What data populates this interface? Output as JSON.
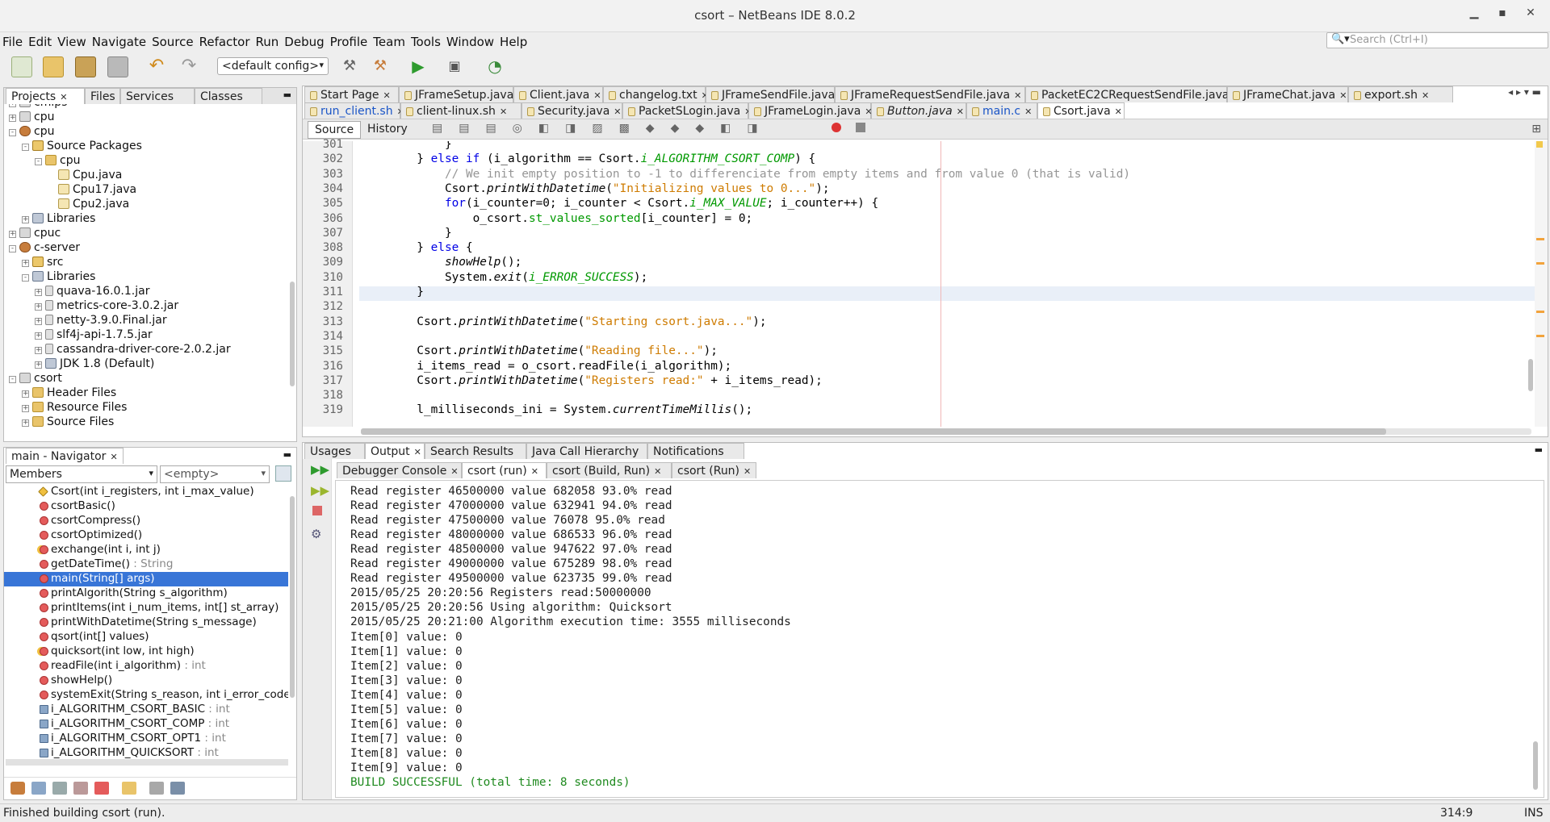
{
  "window": {
    "title": "csort – NetBeans IDE 8.0.2"
  },
  "menu": [
    "File",
    "Edit",
    "View",
    "Navigate",
    "Source",
    "Refactor",
    "Run",
    "Debug",
    "Profile",
    "Team",
    "Tools",
    "Window",
    "Help"
  ],
  "search": {
    "placeholder": "Search (Ctrl+I)"
  },
  "toolbar": {
    "config": "<default config>"
  },
  "projects_panel": {
    "tabs": [
      "Projects",
      "Files",
      "Services",
      "Classes"
    ],
    "tree": [
      {
        "indent": 0,
        "exp": "+",
        "icon": "proj",
        "label": "cmips"
      },
      {
        "indent": 0,
        "exp": "+",
        "icon": "proj",
        "label": "cpu"
      },
      {
        "indent": 0,
        "exp": "-",
        "icon": "cup",
        "label": "cpu"
      },
      {
        "indent": 1,
        "exp": "-",
        "icon": "pkg",
        "label": "Source Packages"
      },
      {
        "indent": 2,
        "exp": "-",
        "icon": "folder",
        "label": "cpu"
      },
      {
        "indent": 3,
        "exp": "",
        "icon": "java",
        "label": "Cpu.java"
      },
      {
        "indent": 3,
        "exp": "",
        "icon": "java",
        "label": "Cpu17.java"
      },
      {
        "indent": 3,
        "exp": "",
        "icon": "java",
        "label": "Cpu2.java"
      },
      {
        "indent": 1,
        "exp": "+",
        "icon": "lib",
        "label": "Libraries"
      },
      {
        "indent": 0,
        "exp": "+",
        "icon": "proj",
        "label": "cpuc"
      },
      {
        "indent": 0,
        "exp": "-",
        "icon": "cup",
        "label": "c-server"
      },
      {
        "indent": 1,
        "exp": "+",
        "icon": "pkg",
        "label": "src"
      },
      {
        "indent": 1,
        "exp": "-",
        "icon": "lib",
        "label": "Libraries"
      },
      {
        "indent": 2,
        "exp": "+",
        "icon": "jar",
        "label": "quava-16.0.1.jar"
      },
      {
        "indent": 2,
        "exp": "+",
        "icon": "jar",
        "label": "metrics-core-3.0.2.jar"
      },
      {
        "indent": 2,
        "exp": "+",
        "icon": "jar",
        "label": "netty-3.9.0.Final.jar"
      },
      {
        "indent": 2,
        "exp": "+",
        "icon": "jar",
        "label": "slf4j-api-1.7.5.jar"
      },
      {
        "indent": 2,
        "exp": "+",
        "icon": "jar",
        "label": "cassandra-driver-core-2.0.2.jar"
      },
      {
        "indent": 2,
        "exp": "+",
        "icon": "lib",
        "label": "JDK 1.8 (Default)"
      },
      {
        "indent": 0,
        "exp": "-",
        "icon": "proj",
        "label": "csort"
      },
      {
        "indent": 1,
        "exp": "+",
        "icon": "folder",
        "label": "Header Files"
      },
      {
        "indent": 1,
        "exp": "+",
        "icon": "folder",
        "label": "Resource Files"
      },
      {
        "indent": 1,
        "exp": "+",
        "icon": "folder",
        "label": "Source Files"
      }
    ]
  },
  "navigator": {
    "title": "main - Navigator",
    "filter": "Members",
    "empty": "<empty>",
    "items": [
      {
        "kind": "ctor",
        "name": "Csort(int i_registers, int i_max_value)",
        "type": ""
      },
      {
        "kind": "method",
        "name": "csortBasic()",
        "type": ""
      },
      {
        "kind": "method",
        "name": "csortCompress()",
        "type": ""
      },
      {
        "kind": "method",
        "name": "csortOptimized()",
        "type": ""
      },
      {
        "kind": "prot",
        "name": "exchange(int i, int j)",
        "type": ""
      },
      {
        "kind": "method",
        "name": "getDateTime()",
        "type": " : String"
      },
      {
        "kind": "method",
        "name": "main(String[] args)",
        "type": ""
      },
      {
        "kind": "method",
        "name": "printAlgorith(String s_algorithm)",
        "type": ""
      },
      {
        "kind": "method",
        "name": "printItems(int i_num_items, int[] st_array)",
        "type": ""
      },
      {
        "kind": "method",
        "name": "printWithDatetime(String s_message)",
        "type": ""
      },
      {
        "kind": "method",
        "name": "qsort(int[] values)",
        "type": ""
      },
      {
        "kind": "prot",
        "name": "quicksort(int low, int high)",
        "type": ""
      },
      {
        "kind": "method",
        "name": "readFile(int i_algorithm)",
        "type": " : int"
      },
      {
        "kind": "method",
        "name": "showHelp()",
        "type": ""
      },
      {
        "kind": "method",
        "name": "systemExit(String s_reason, int i_error_code",
        "type": ""
      },
      {
        "kind": "fieldico",
        "name": "i_ALGORITHM_CSORT_BASIC",
        "type": " : int"
      },
      {
        "kind": "fieldico",
        "name": "i_ALGORITHM_CSORT_COMP",
        "type": " : int"
      },
      {
        "kind": "fieldico",
        "name": "i_ALGORITHM_CSORT_OPT1",
        "type": " : int"
      },
      {
        "kind": "fieldico",
        "name": "i_ALGORITHM_QUICKSORT",
        "type": " : int"
      }
    ]
  },
  "editor": {
    "tabs_row1": [
      "Start Page",
      "JFrameSetup.java",
      "Client.java",
      "changelog.txt",
      "JFrameSendFile.java",
      "JFrameRequestSendFile.java",
      "PacketEC2CRequestSendFile.java",
      "JFrameChat.java",
      "export.sh"
    ],
    "tabs_row2": [
      "run_client.sh",
      "client-linux.sh",
      "Security.java",
      "PacketSLogin.java",
      "JFrameLogin.java",
      "Button.java",
      "main.c",
      "Csort.java"
    ],
    "source_tab": "Source",
    "history_tab": "History",
    "lines": [
      {
        "n": "301",
        "html": "            }"
      },
      {
        "n": "302",
        "html": "        } <span class=\"kw\">else if</span> (i_algorithm == Csort.<span class=\"sfld\">i_ALGORITHM_CSORT_COMP</span>) {"
      },
      {
        "n": "303",
        "html": "            <span class=\"cm\">// We init empty position to -1 to differenciate from empty items and from value 0 (that is valid)</span>"
      },
      {
        "n": "304",
        "html": "            Csort.<span class=\"it\">printWithDatetime</span>(<span class=\"str\">\"Initializing values to 0...\"</span>);"
      },
      {
        "n": "305",
        "html": "            <span class=\"kw\">for</span>(i_counter=0; i_counter &lt; Csort.<span class=\"sfld\">i_MAX_VALUE</span>; i_counter++) {"
      },
      {
        "n": "306",
        "html": "                o_csort.<span class=\"fld\">st_values_sorted</span>[i_counter] = 0;"
      },
      {
        "n": "307",
        "html": "            }"
      },
      {
        "n": "308",
        "html": "        } <span class=\"kw\">else</span> {"
      },
      {
        "n": "309",
        "html": "            <span class=\"it\">showHelp</span>();"
      },
      {
        "n": "310",
        "html": "            System.<span class=\"it\">exit</span>(<span class=\"sfld\">i_ERROR_SUCCESS</span>);"
      },
      {
        "n": "311",
        "html": "        }"
      },
      {
        "n": "312",
        "html": ""
      },
      {
        "n": "313",
        "html": "        Csort.<span class=\"it\">printWithDatetime</span>(<span class=\"str\">\"Starting csort.java...\"</span>);"
      },
      {
        "n": "314",
        "html": ""
      },
      {
        "n": "315",
        "html": "        Csort.<span class=\"it\">printWithDatetime</span>(<span class=\"str\">\"Reading file...\"</span>);"
      },
      {
        "n": "316",
        "html": "        i_items_read = o_csort.readFile(i_algorithm);"
      },
      {
        "n": "317",
        "html": "        Csort.<span class=\"it\">printWithDatetime</span>(<span class=\"str\">\"Registers read:\"</span> + i_items_read);"
      },
      {
        "n": "318",
        "html": ""
      },
      {
        "n": "319",
        "html": "        l_milliseconds_ini = System.<span class=\"it\">currentTimeMillis</span>();"
      }
    ]
  },
  "bottom_panel": {
    "tabs": [
      "Usages",
      "Output",
      "Search Results",
      "Java Call Hierarchy",
      "Notifications"
    ],
    "output_tabs": [
      "Debugger Console",
      "csort (run)",
      "csort (Build, Run)",
      "csort (Run)"
    ],
    "lines": [
      "Read register 46500000 value 682058 93.0% read",
      "Read register 47000000 value 632941 94.0% read",
      "Read register 47500000 value 76078 95.0% read",
      "Read register 48000000 value 686533 96.0% read",
      "Read register 48500000 value 947622 97.0% read",
      "Read register 49000000 value 675289 98.0% read",
      "Read register 49500000 value 623735 99.0% read",
      "2015/05/25 20:20:56 Registers read:50000000",
      "2015/05/25 20:20:56 Using algorithm: Quicksort",
      "2015/05/25 20:21:00 Algorithm execution time: 3555 milliseconds",
      "Item[0] value: 0",
      "Item[1] value: 0",
      "Item[2] value: 0",
      "Item[3] value: 0",
      "Item[4] value: 0",
      "Item[5] value: 0",
      "Item[6] value: 0",
      "Item[7] value: 0",
      "Item[8] value: 0",
      "Item[9] value: 0"
    ],
    "build": "BUILD SUCCESSFUL (total time: 8 seconds)"
  },
  "status": {
    "message": "Finished building csort (run).",
    "position": "314:9",
    "mode": "INS"
  }
}
